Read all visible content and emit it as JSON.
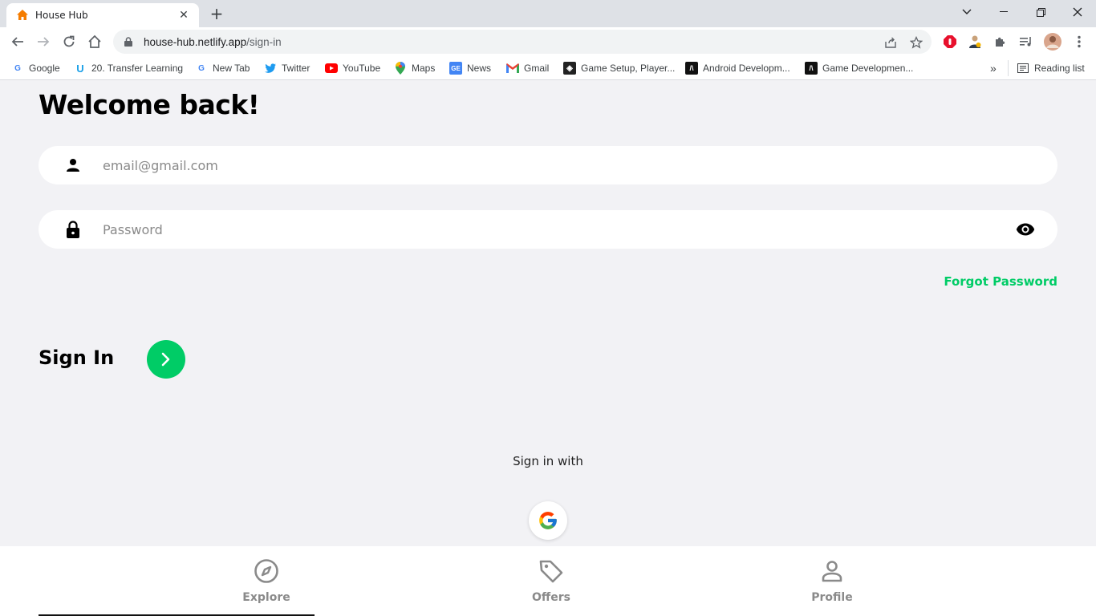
{
  "browser": {
    "tab_title": "House Hub",
    "url_host": "house-hub.netlify.app",
    "url_path": "/sign-in",
    "bookmarks": [
      {
        "label": "Google",
        "icon": "google-icon"
      },
      {
        "label": "20. Transfer Learning",
        "icon": "udemy-icon"
      },
      {
        "label": "New Tab",
        "icon": "google-icon"
      },
      {
        "label": "Twitter",
        "icon": "twitter-icon"
      },
      {
        "label": "YouTube",
        "icon": "youtube-icon"
      },
      {
        "label": "Maps",
        "icon": "maps-icon"
      },
      {
        "label": "News",
        "icon": "news-icon"
      },
      {
        "label": "Gmail",
        "icon": "gmail-icon"
      },
      {
        "label": "Game Setup, Player...",
        "icon": "unity-icon"
      },
      {
        "label": "Android Developm...",
        "icon": "unreal-icon"
      },
      {
        "label": "Game Developmen...",
        "icon": "unreal-icon"
      }
    ],
    "more_bookmarks": "»",
    "reading_list": "Reading list"
  },
  "page": {
    "heading": "Welcome back!",
    "email_placeholder": "email@gmail.com",
    "password_placeholder": "Password",
    "forgot_password": "Forgot Password",
    "sign_in_label": "Sign In",
    "sign_in_with": "Sign in with"
  },
  "navbar": {
    "items": [
      {
        "label": "Explore",
        "icon": "compass-icon"
      },
      {
        "label": "Offers",
        "icon": "tag-icon"
      },
      {
        "label": "Profile",
        "icon": "person-icon"
      }
    ]
  },
  "colors": {
    "accent": "#00cc66",
    "background": "#f2f2f5",
    "nav_inactive": "#8a8a8a"
  }
}
